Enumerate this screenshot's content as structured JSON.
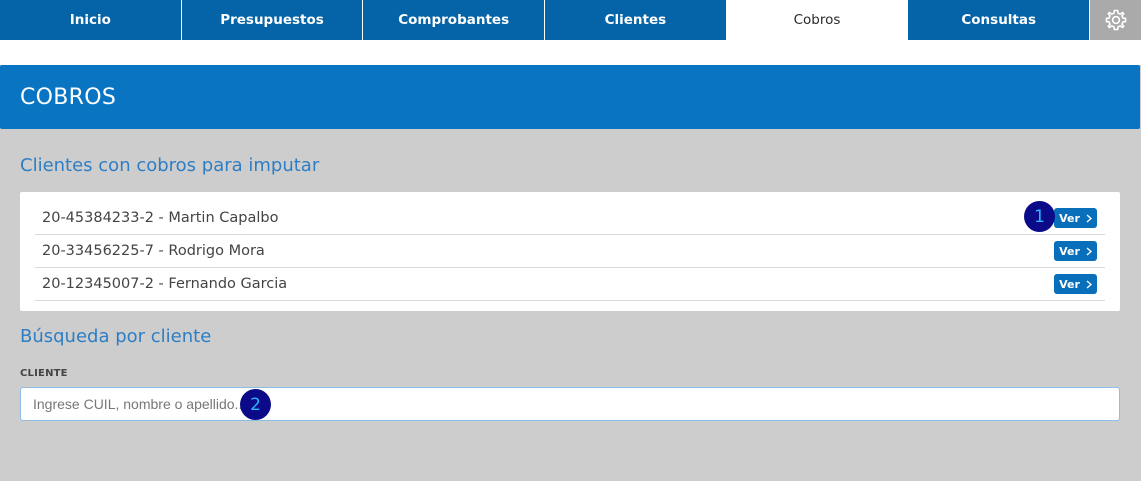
{
  "nav": {
    "tabs": [
      {
        "label": "Inicio"
      },
      {
        "label": "Presupuestos"
      },
      {
        "label": "Comprobantes"
      },
      {
        "label": "Clientes"
      },
      {
        "label": "Cobros"
      },
      {
        "label": "Consultas"
      }
    ],
    "active_tab": "Cobros",
    "settings_icon": "gear-icon"
  },
  "header": {
    "title": "COBROS"
  },
  "pending": {
    "title": "Clientes con cobros para imputar",
    "items": [
      {
        "label": "20-45384233-2 - Martin Capalbo",
        "button": "Ver"
      },
      {
        "label": "20-33456225-7 - Rodrigo Mora",
        "button": "Ver"
      },
      {
        "label": "20-12345007-2 - Fernando Garcia",
        "button": "Ver"
      }
    ]
  },
  "search": {
    "title": "Búsqueda por cliente",
    "field_label": "CLIENTE",
    "placeholder": "Ingrese CUIL, nombre o apellido..."
  },
  "annotations": [
    "1",
    "2"
  ],
  "colors": {
    "nav_bg": "#0564a8",
    "header_bg": "#0874c2",
    "section_title": "#2d7ec4",
    "page_bg": "#cdcdcd",
    "button_bg": "#0a6fba"
  }
}
